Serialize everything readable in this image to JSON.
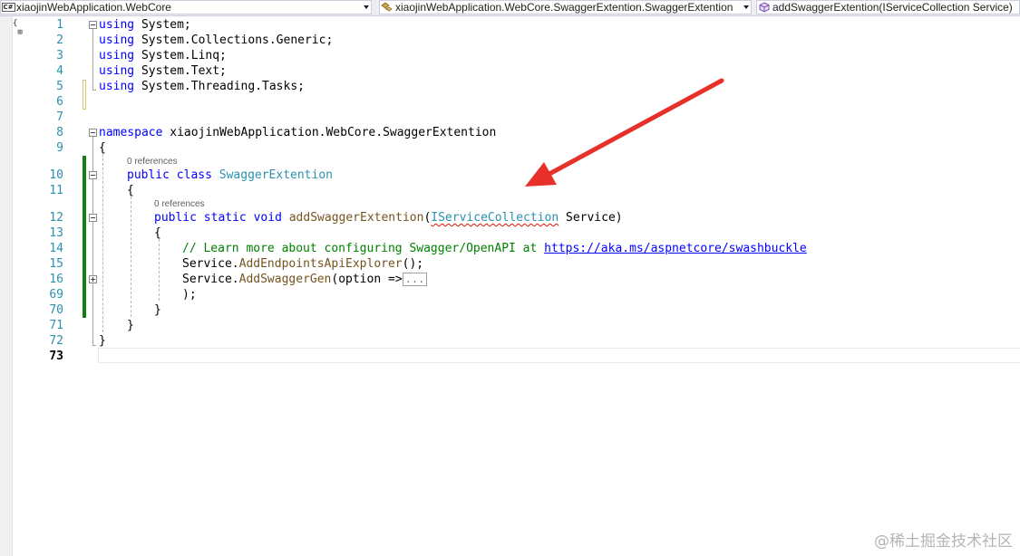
{
  "navbar": {
    "project": {
      "icon": "csharp-project-icon",
      "label": "xiaojinWebApplication.WebCore"
    },
    "type": {
      "icon": "class-icon",
      "label": "xiaojinWebApplication.WebCore.SwaggerExtention.SwaggerExtention"
    },
    "member": {
      "icon": "method-icon",
      "label": "addSwaggerExtention(IServiceCollection Service)"
    }
  },
  "editor": {
    "line_numbers": [
      "1",
      "2",
      "3",
      "4",
      "5",
      "6",
      "7",
      "8",
      "9",
      "10",
      "11",
      "12",
      "13",
      "14",
      "15",
      "16",
      "69",
      "70",
      "71",
      "72",
      "73"
    ],
    "current_line": "73",
    "codelens": {
      "class_refs": "0 references",
      "method_refs": "0 references"
    },
    "code": {
      "l1": {
        "kw": "using",
        "rest": " System;"
      },
      "l2": {
        "kw": "using",
        "rest": " System.Collections.Generic;"
      },
      "l3": {
        "kw": "using",
        "rest": " System.Linq;"
      },
      "l4": {
        "kw": "using",
        "rest": " System.Text;"
      },
      "l5": {
        "kw": "using",
        "rest": " System.Threading.Tasks;"
      },
      "l8": {
        "kw": "namespace",
        "rest": " xiaojinWebApplication.WebCore.SwaggerExtention"
      },
      "l9": "{",
      "l10": {
        "kw1": "public",
        "kw2": "class",
        "type": "SwaggerExtention"
      },
      "l11": "{",
      "l12": {
        "kw1": "public",
        "kw2": "static",
        "kw3": "void",
        "method": "addSwaggerExtention",
        "open": "(",
        "param_type": "IServiceCollection",
        "param_name": " Service)"
      },
      "l13": "{",
      "l14": {
        "comment": "// Learn more about configuring Swagger/OpenAPI at ",
        "link": "https://aka.ms/aspnetcore/swashbuckle"
      },
      "l15": {
        "obj": "Service",
        "call": ".",
        "method": "AddEndpointsApiExplorer",
        "tail": "();"
      },
      "l16": {
        "obj": "Service",
        "call": ".",
        "method": "AddSwaggerGen",
        "open": "(option =>",
        "collapsed": "..."
      },
      "l69": ");",
      "l70": "}",
      "l71": "}",
      "l72": "}"
    }
  },
  "watermark": "@稀土掘金技术社区"
}
